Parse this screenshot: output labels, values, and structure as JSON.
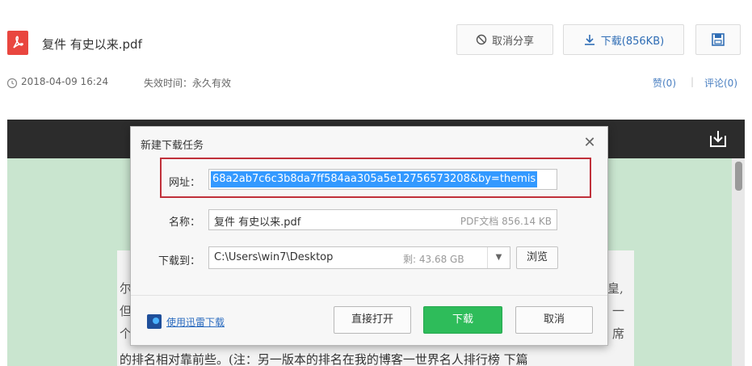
{
  "header": {
    "file_title": "复件 有史以来.pdf",
    "cancel_share_label": "取消分享",
    "download_label": "下载(856KB)",
    "date": "2018-04-09 16:24",
    "expire": "失效时间：永久有效",
    "like": "赞(0)",
    "separator": "|",
    "comment": "评论(0)"
  },
  "viewer": {
    "doc_line": "的排名相对靠前些。(注：另一版本的排名在我的博客一世界名人排行榜 下篇",
    "fragments": [
      "尔",
      "但",
      "个",
      "皇,",
      "一",
      "席"
    ]
  },
  "dialog": {
    "title": "新建下载任务",
    "close": "✕",
    "url_label": "网址：",
    "url_value": "68a2ab7c6c3b8da7ff584aa305a5e12756573208&by=themis",
    "name_label": "名称：",
    "name_value": "复件 有史以来.pdf",
    "name_meta": "PDF文档 856.14 KB",
    "path_label": "下载到：",
    "path_value": "C:\\Users\\win7\\Desktop",
    "path_free": "剩: 43.68 GB",
    "path_arrow": "▼",
    "browse_label": "浏览",
    "xunlei_link": "使用迅雷下载",
    "open_label": "直接打开",
    "download_label": "下载",
    "cancel_label": "取消"
  },
  "colors": {
    "accent_blue": "#2f6db5",
    "download_green": "#2ebc5a",
    "highlight_red": "#c0303a",
    "pdf_red": "#e9463f",
    "viewer_dark": "#2c2c2c",
    "eye_care_green": "#c9e5cf"
  },
  "icons": [
    "pdf-icon",
    "prohibit-icon",
    "download-icon",
    "save-to-disk-icon",
    "clock-icon",
    "viewer-download-icon",
    "close-icon",
    "xunlei-icon"
  ]
}
